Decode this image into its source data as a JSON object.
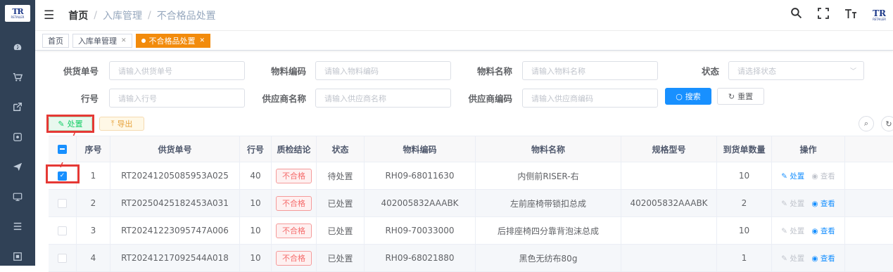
{
  "sidebar": {
    "logo_text": "TR",
    "logo_sub": "RETAILER",
    "icons": [
      "dashboard-icon",
      "cart-icon",
      "export-icon",
      "package-icon",
      "send-icon",
      "monitor-icon",
      "list-icon",
      "box-icon"
    ]
  },
  "navbar": {
    "breadcrumb": [
      "首页",
      "入库管理",
      "不合格品处置"
    ],
    "logo_text": "TR",
    "logo_sub": "RETAILER"
  },
  "tags": [
    {
      "label": "首页",
      "active": false,
      "closable": false
    },
    {
      "label": "入库单管理",
      "active": false,
      "closable": true
    },
    {
      "label": "不合格品处置",
      "active": true,
      "closable": true
    }
  ],
  "form": {
    "supply_no": {
      "label": "供货单号",
      "placeholder": "请输入供货单号"
    },
    "material_code": {
      "label": "物料编码",
      "placeholder": "请输入物料编码"
    },
    "material_name": {
      "label": "物料名称",
      "placeholder": "请输入物料名称"
    },
    "status": {
      "label": "状态",
      "placeholder": "请选择状态"
    },
    "line_no": {
      "label": "行号",
      "placeholder": "请输入行号"
    },
    "supplier_name": {
      "label": "供应商名称",
      "placeholder": "请输入供应商名称"
    },
    "supplier_code": {
      "label": "供应商编码",
      "placeholder": "请输入供应商编码"
    },
    "search_label": "搜索",
    "reset_label": "重置"
  },
  "toolbar": {
    "handle_label": "处置",
    "export_label": "导出"
  },
  "table": {
    "headers": [
      "序号",
      "供货单号",
      "行号",
      "质检结论",
      "状态",
      "物料编码",
      "物料名称",
      "规格型号",
      "到货单数量",
      "操作"
    ],
    "rows": [
      {
        "checked": true,
        "index": "1",
        "supply_no": "RT20241205085953A025",
        "line": "40",
        "qc": "不合格",
        "status": "待处置",
        "code": "RH09-68011630",
        "name": "内侧前RISER-右",
        "spec": "",
        "qty": "10",
        "op_handle": "处置",
        "op_view": "查看",
        "handle_enabled": true,
        "view_enabled": false
      },
      {
        "checked": false,
        "index": "2",
        "supply_no": "RT20250425182453A031",
        "line": "10",
        "qc": "不合格",
        "status": "已处置",
        "code": "402005832AAABK",
        "name": "左前座椅带锁扣总成",
        "spec": "402005832AAABK",
        "qty": "2",
        "op_handle": "处置",
        "op_view": "查看",
        "handle_enabled": false,
        "view_enabled": true
      },
      {
        "checked": false,
        "index": "3",
        "supply_no": "RT20241223095747A006",
        "line": "10",
        "qc": "不合格",
        "status": "已处置",
        "code": "RH09-70033000",
        "name": "后排座椅四分靠背泡沫总成",
        "spec": "",
        "qty": "10",
        "op_handle": "处置",
        "op_view": "查看",
        "handle_enabled": false,
        "view_enabled": true
      },
      {
        "checked": false,
        "index": "4",
        "supply_no": "RT20241217092544A018",
        "line": "10",
        "qc": "不合格",
        "status": "已处置",
        "code": "RH09-68021880",
        "name": "黑色无纺布80g",
        "spec": "",
        "qty": "1",
        "op_handle": "处置",
        "op_view": "查看",
        "handle_enabled": false,
        "view_enabled": true
      }
    ]
  },
  "colors": {
    "primary": "#1890ff",
    "accent_tag": "#f28b0c",
    "danger": "#f56c6c",
    "highlight": "#e53935"
  }
}
